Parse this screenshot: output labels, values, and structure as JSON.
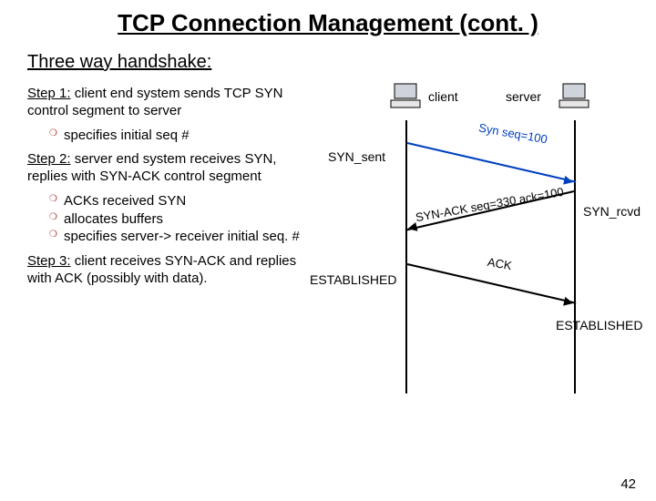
{
  "title": "TCP Connection Management (cont. )",
  "subtitle": "Three way handshake:",
  "steps": {
    "s1_label": "Step 1:",
    "s1_text": " client end system sends TCP SYN control segment to server",
    "s1_b1": "specifies initial seq #",
    "s2_label": "Step 2:",
    "s2_text": " server end system receives SYN, replies with SYN-ACK control segment",
    "s2_b1": "ACKs received SYN",
    "s2_b2": "allocates buffers",
    "s2_b3": "specifies server-> receiver initial seq. #",
    "s3_label": "Step 3:",
    "s3_text": " client receives SYN-ACK and replies with ACK (possibly with data)."
  },
  "diagram": {
    "client_label": "client",
    "server_label": "server",
    "syn_sent": "SYN_sent",
    "syn_rcvd": "SYN_rcvd",
    "established_client": "ESTABLISHED",
    "established_server": "ESTABLISHED",
    "msg1": "Syn seq=100",
    "msg2": "SYN-ACK seq=330 ack=100",
    "msg3": "ACK"
  },
  "slide_number": "42"
}
